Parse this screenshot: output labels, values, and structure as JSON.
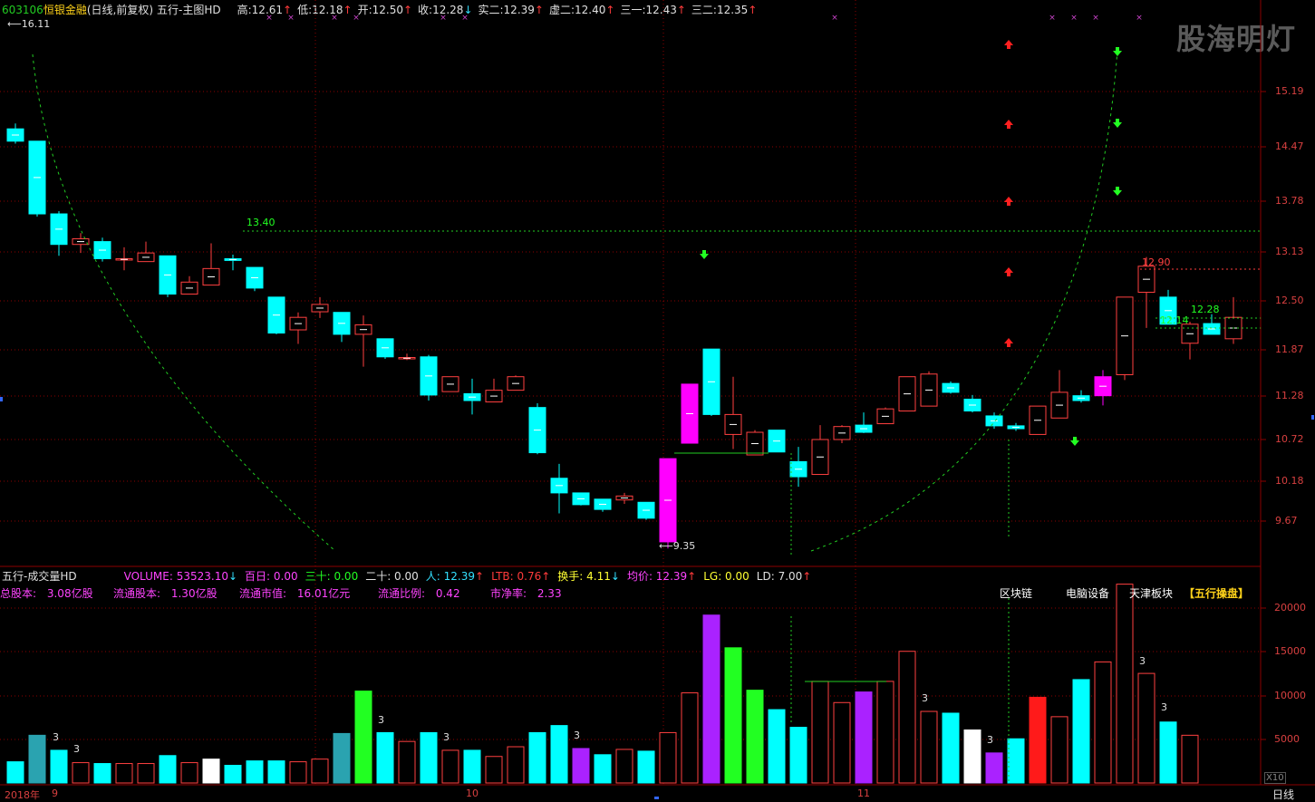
{
  "main_header": {
    "code": "603106",
    "name": "恒银金融",
    "period": "(日线,前复权)",
    "indicator": "五行-主图HD",
    "items": [
      {
        "label": "高:",
        "value": "12.61",
        "arrow": "↑",
        "color": "red"
      },
      {
        "label": "低:",
        "value": "12.18",
        "arrow": "↑",
        "color": "red"
      },
      {
        "label": "开:",
        "value": "12.50",
        "arrow": "↑",
        "color": "red"
      },
      {
        "label": "收:",
        "value": "12.28",
        "arrow": "↓",
        "color": "cyan"
      },
      {
        "label": "实二:",
        "value": "12.39",
        "arrow": "↑",
        "color": "red"
      },
      {
        "label": "虚二:",
        "value": "12.40",
        "arrow": "↑",
        "color": "red"
      },
      {
        "label": "三一:",
        "value": "12.43",
        "arrow": "↑",
        "color": "red"
      },
      {
        "label": "三二:",
        "value": "12.35",
        "arrow": "↑",
        "color": "red"
      }
    ]
  },
  "watermark": "股海明灯",
  "price_labels": {
    "high": "16.11",
    "level": "13.40",
    "low": "9.35",
    "r1": "12.90",
    "r2": "12.28",
    "r3": "12.14"
  },
  "price_axis": [
    "15.19",
    "14.47",
    "13.78",
    "13.13",
    "12.50",
    "11.87",
    "11.28",
    "10.72",
    "10.18",
    "9.67"
  ],
  "volume_header": {
    "name": "五行-成交量HD",
    "items": [
      {
        "label": "VOLUME:",
        "value": "53523.10",
        "arrow": "↓",
        "color": "magenta"
      },
      {
        "label": "百日:",
        "value": "0.00",
        "arrow": "",
        "color": "magenta"
      },
      {
        "label": "三十:",
        "value": "0.00",
        "arrow": "",
        "color": "green"
      },
      {
        "label": "二十:",
        "value": "0.00",
        "arrow": "",
        "color": "white"
      },
      {
        "label": "人:",
        "value": "12.39",
        "arrow": "↑",
        "color": "cyan"
      },
      {
        "label": "LTB:",
        "value": "0.76",
        "arrow": "↑",
        "color": "red"
      },
      {
        "label": "换手:",
        "value": "4.11",
        "arrow": "↓",
        "color": "yellow"
      },
      {
        "label": "均价:",
        "value": "12.39",
        "arrow": "↑",
        "color": "magenta"
      },
      {
        "label": "LG:",
        "value": "0.00",
        "arrow": "",
        "color": "yellow"
      },
      {
        "label": "LD:",
        "value": "7.00",
        "arrow": "↑",
        "color": "white"
      }
    ]
  },
  "fundamentals": [
    {
      "label": "总股本:",
      "value": "3.08亿股"
    },
    {
      "label": "流通股本:",
      "value": "1.30亿股"
    },
    {
      "label": "流通市值:",
      "value": "16.01亿元"
    },
    {
      "label": "流通比例:",
      "value": "0.42"
    },
    {
      "label": "市净率:",
      "value": "2.33"
    }
  ],
  "sectors": [
    "区块链",
    "电脑设备",
    "天津板块",
    "【五行操盘】"
  ],
  "volume_axis": [
    "20000",
    "15000",
    "10000",
    "5000"
  ],
  "volume_unit": "X10",
  "date_axis": {
    "year": "2018年",
    "m9": "9",
    "m10": "10",
    "m11": "11"
  },
  "period_button": "日线",
  "vol_marks": [
    "3",
    "3",
    "3",
    "3",
    "3",
    "3",
    "3",
    "3"
  ],
  "colors": {
    "up": "#ff4040",
    "down": "#00ffff",
    "bg": "#000000",
    "grid": "#8b0000",
    "dash_green": "#22cc22",
    "magenta": "#ff00ff"
  },
  "chart_data": {
    "type": "candlestick",
    "price_ylim": [
      9.35,
      16.11
    ],
    "candles": [
      {
        "o": 16.0,
        "h": 16.11,
        "l": 15.7,
        "c": 15.75
      },
      {
        "o": 15.75,
        "h": 15.75,
        "l": 14.3,
        "c": 14.35
      },
      {
        "o": 14.35,
        "h": 14.4,
        "l": 13.6,
        "c": 13.8
      },
      {
        "o": 13.8,
        "h": 14.0,
        "l": 13.65,
        "c": 13.9
      },
      {
        "o": 13.85,
        "h": 13.92,
        "l": 13.5,
        "c": 13.55
      },
      {
        "o": 13.55,
        "h": 13.75,
        "l": 13.35,
        "c": 13.55
      },
      {
        "o": 13.5,
        "h": 13.85,
        "l": 13.5,
        "c": 13.65
      },
      {
        "o": 13.6,
        "h": 13.6,
        "l": 12.9,
        "c": 12.95
      },
      {
        "o": 12.95,
        "h": 13.25,
        "l": 12.95,
        "c": 13.15
      },
      {
        "o": 13.1,
        "h": 13.82,
        "l": 13.1,
        "c": 13.38
      },
      {
        "o": 13.55,
        "h": 13.62,
        "l": 13.35,
        "c": 13.52
      },
      {
        "o": 13.4,
        "h": 13.4,
        "l": 13.0,
        "c": 13.05
      },
      {
        "o": 12.9,
        "h": 12.9,
        "l": 12.3,
        "c": 12.32
      },
      {
        "o": 12.37,
        "h": 12.65,
        "l": 12.15,
        "c": 12.57
      },
      {
        "o": 12.66,
        "h": 12.9,
        "l": 12.56,
        "c": 12.78
      },
      {
        "o": 12.65,
        "h": 12.65,
        "l": 12.18,
        "c": 12.3
      },
      {
        "o": 12.3,
        "h": 12.6,
        "l": 11.8,
        "c": 12.45
      },
      {
        "o": 12.23,
        "h": 12.23,
        "l": 11.92,
        "c": 11.95
      },
      {
        "o": 11.94,
        "h": 12.0,
        "l": 11.9,
        "c": 11.94
      },
      {
        "o": 11.95,
        "h": 11.98,
        "l": 11.3,
        "c": 11.38
      },
      {
        "o": 11.43,
        "h": 11.65,
        "l": 11.43,
        "c": 11.65
      },
      {
        "o": 11.4,
        "h": 11.62,
        "l": 11.1,
        "c": 11.3
      },
      {
        "o": 11.28,
        "h": 11.62,
        "l": 11.28,
        "c": 11.45
      },
      {
        "o": 11.45,
        "h": 11.67,
        "l": 11.45,
        "c": 11.65
      },
      {
        "o": 11.2,
        "h": 11.26,
        "l": 10.55,
        "c": 10.57
      },
      {
        "o": 10.23,
        "h": 10.42,
        "l": 9.78,
        "c": 10.04
      },
      {
        "o": 10.04,
        "h": 10.04,
        "l": 9.88,
        "c": 9.89
      },
      {
        "o": 9.96,
        "h": 9.96,
        "l": 9.8,
        "c": 9.83
      },
      {
        "o": 9.95,
        "h": 10.04,
        "l": 9.9,
        "c": 10.0
      },
      {
        "o": 9.92,
        "h": 9.92,
        "l": 9.7,
        "c": 9.72
      },
      {
        "o": 9.43,
        "h": 10.49,
        "l": 9.35,
        "c": 10.49
      },
      {
        "o": 10.7,
        "h": 11.54,
        "l": 10.7,
        "c": 11.54
      },
      {
        "o": 12.07,
        "h": 12.07,
        "l": 11.08,
        "c": 11.1
      },
      {
        "o": 10.82,
        "h": 11.65,
        "l": 10.62,
        "c": 11.1
      },
      {
        "o": 10.54,
        "h": 10.88,
        "l": 10.54,
        "c": 10.85
      },
      {
        "o": 10.88,
        "h": 10.88,
        "l": 10.58,
        "c": 10.58
      },
      {
        "o": 10.45,
        "h": 10.65,
        "l": 10.12,
        "c": 10.25
      },
      {
        "o": 10.28,
        "h": 10.95,
        "l": 10.28,
        "c": 10.75
      },
      {
        "o": 10.75,
        "h": 10.95,
        "l": 10.7,
        "c": 10.93
      },
      {
        "o": 10.95,
        "h": 11.13,
        "l": 10.84,
        "c": 10.85
      },
      {
        "o": 10.97,
        "h": 11.2,
        "l": 10.97,
        "c": 11.18
      },
      {
        "o": 11.15,
        "h": 11.5,
        "l": 11.15,
        "c": 11.65
      },
      {
        "o": 11.22,
        "h": 11.73,
        "l": 11.22,
        "c": 11.69
      },
      {
        "o": 11.55,
        "h": 11.58,
        "l": 11.4,
        "c": 11.42
      },
      {
        "o": 11.32,
        "h": 11.38,
        "l": 11.13,
        "c": 11.15
      },
      {
        "o": 11.08,
        "h": 11.13,
        "l": 10.9,
        "c": 10.94
      },
      {
        "o": 10.94,
        "h": 10.98,
        "l": 10.87,
        "c": 10.9
      },
      {
        "o": 10.82,
        "h": 11.22,
        "l": 10.82,
        "c": 11.22
      },
      {
        "o": 11.05,
        "h": 11.75,
        "l": 11.05,
        "c": 11.42
      },
      {
        "o": 11.37,
        "h": 11.45,
        "l": 11.27,
        "c": 11.3
      },
      {
        "o": 11.37,
        "h": 11.75,
        "l": 11.23,
        "c": 11.65
      },
      {
        "o": 11.68,
        "h": 12.9,
        "l": 11.6,
        "c": 12.9
      },
      {
        "o": 12.98,
        "h": 13.58,
        "l": 12.4,
        "c": 13.42
      },
      {
        "o": 12.9,
        "h": 13.02,
        "l": 12.46,
        "c": 12.46
      },
      {
        "o": 12.16,
        "h": 12.5,
        "l": 11.91,
        "c": 12.46
      },
      {
        "o": 12.47,
        "h": 12.62,
        "l": 12.32,
        "c": 12.3
      },
      {
        "o": 12.23,
        "h": 12.9,
        "l": 12.15,
        "c": 12.57
      }
    ],
    "volumes": [
      2400,
      5400,
      3700,
      2300,
      2200,
      2200,
      2200,
      3100,
      2300,
      2700,
      2000,
      2500,
      2500,
      2400,
      2700,
      5600,
      10400,
      5700,
      4700,
      5700,
      3700,
      3700,
      3000,
      4100,
      5700,
      6500,
      3900,
      3200,
      3800,
      3600,
      5700,
      10200,
      19000,
      15300,
      10500,
      8300,
      6300,
      11500,
      9100,
      10300,
      11500,
      14900,
      8100,
      7900,
      6000,
      3400,
      5000,
      9700,
      7500,
      11700,
      13700,
      22500,
      12400,
      6900,
      5400
    ],
    "title": "",
    "xlabel": "",
    "ylabel": ""
  }
}
